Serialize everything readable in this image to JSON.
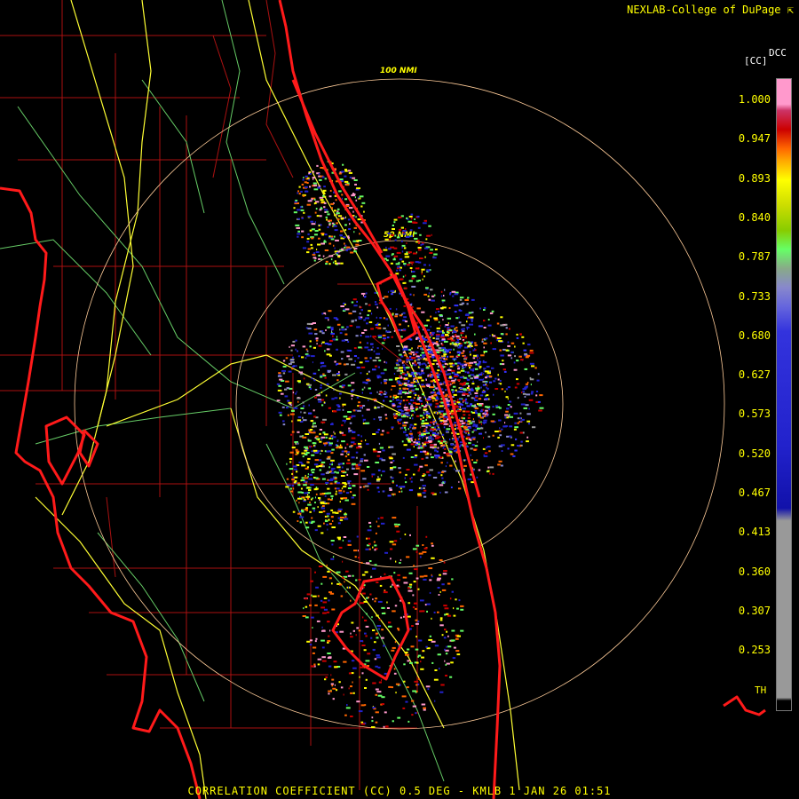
{
  "credit": "NEXLAB-College of DuPage",
  "credit_icon": "cursor-arrow-icon",
  "footer": "CORRELATION COEFFICIENT (CC) 0.5 DEG - KMLB 1 JAN 26 01:51",
  "rings": {
    "outer_label": "100 NMI",
    "inner_label": "50 NMI"
  },
  "legend": {
    "product": "DCC",
    "units": "[CC]",
    "ticks": [
      "1.000",
      "0.947",
      "0.893",
      "0.840",
      "0.787",
      "0.733",
      "0.680",
      "0.627",
      "0.573",
      "0.520",
      "0.467",
      "0.413",
      "0.360",
      "0.307",
      "0.253"
    ],
    "footer_code": "TH",
    "colors": {
      "pink": "#ff99cc",
      "red": "#cc0000",
      "orange": "#ff6600",
      "yellow": "#ffff00",
      "green": "#66ff66",
      "lavender": "#8888cc",
      "blue": "#2222cc",
      "gray": "#999999"
    }
  },
  "map_colors": {
    "coast": "#ff1a1a",
    "county": "#aa1111",
    "roads": "#ffff33",
    "rivers": "#66cc66",
    "rings": "#ffcc99"
  }
}
